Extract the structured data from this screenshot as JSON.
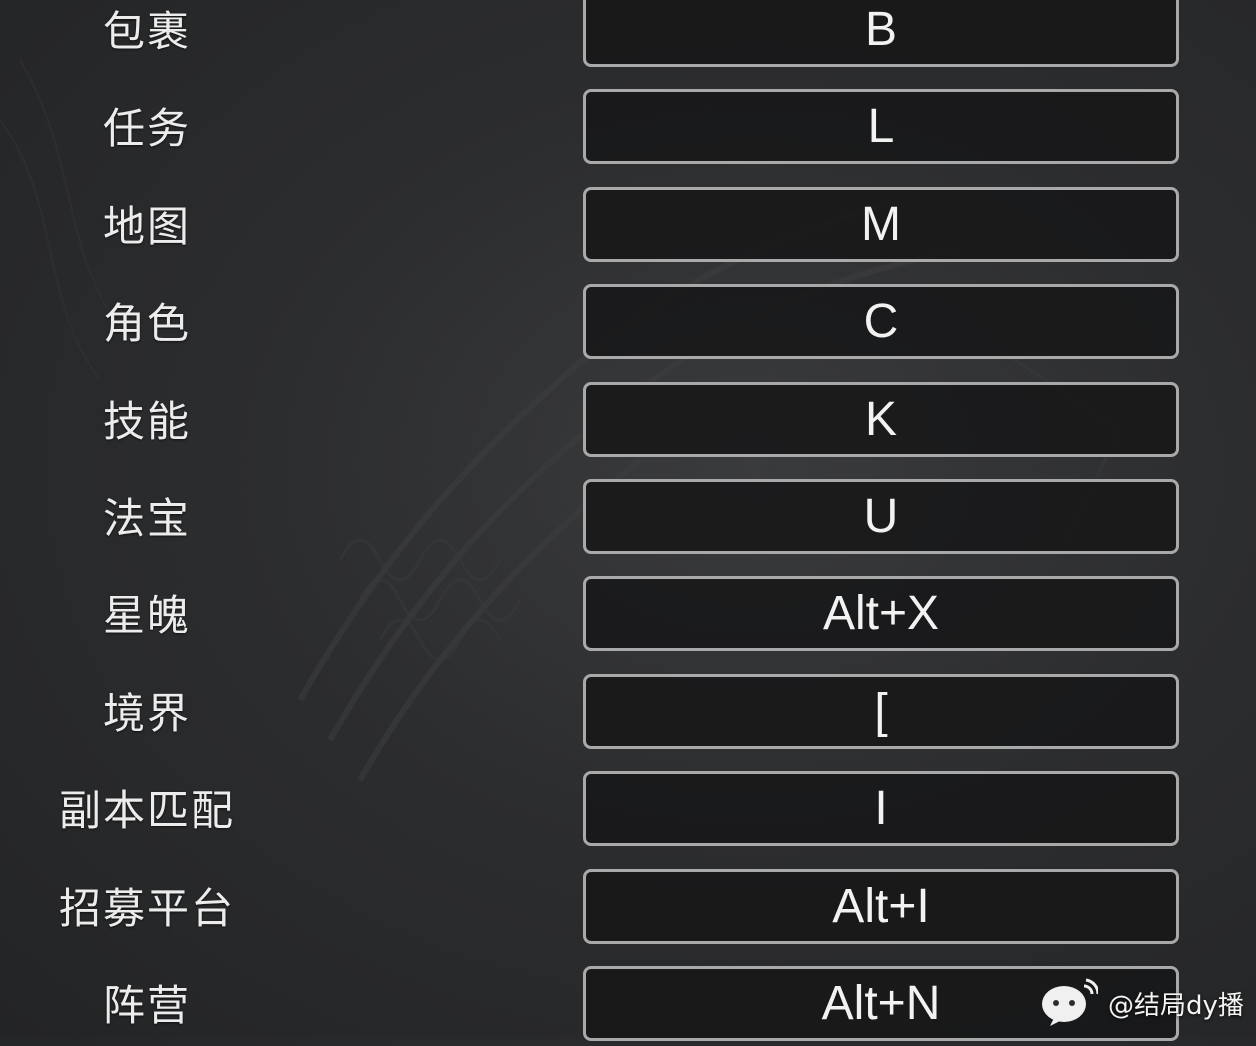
{
  "keybindings": [
    {
      "action": "包裹",
      "key": "B"
    },
    {
      "action": "任务",
      "key": "L"
    },
    {
      "action": "地图",
      "key": "M"
    },
    {
      "action": "角色",
      "key": "C"
    },
    {
      "action": "技能",
      "key": "K"
    },
    {
      "action": "法宝",
      "key": "U"
    },
    {
      "action": "星魄",
      "key": "Alt+X"
    },
    {
      "action": "境界",
      "key": "["
    },
    {
      "action": "副本匹配",
      "key": "I"
    },
    {
      "action": "招募平台",
      "key": "Alt+I"
    },
    {
      "action": "阵营",
      "key": "Alt+N"
    }
  ],
  "watermark": {
    "icon": "wechat-channel-icon",
    "text": "@结局dy播"
  },
  "colors": {
    "background": "#2c2d2f",
    "key_border": "#a9a9a9",
    "key_fill": "#161617",
    "text": "#ececec"
  }
}
